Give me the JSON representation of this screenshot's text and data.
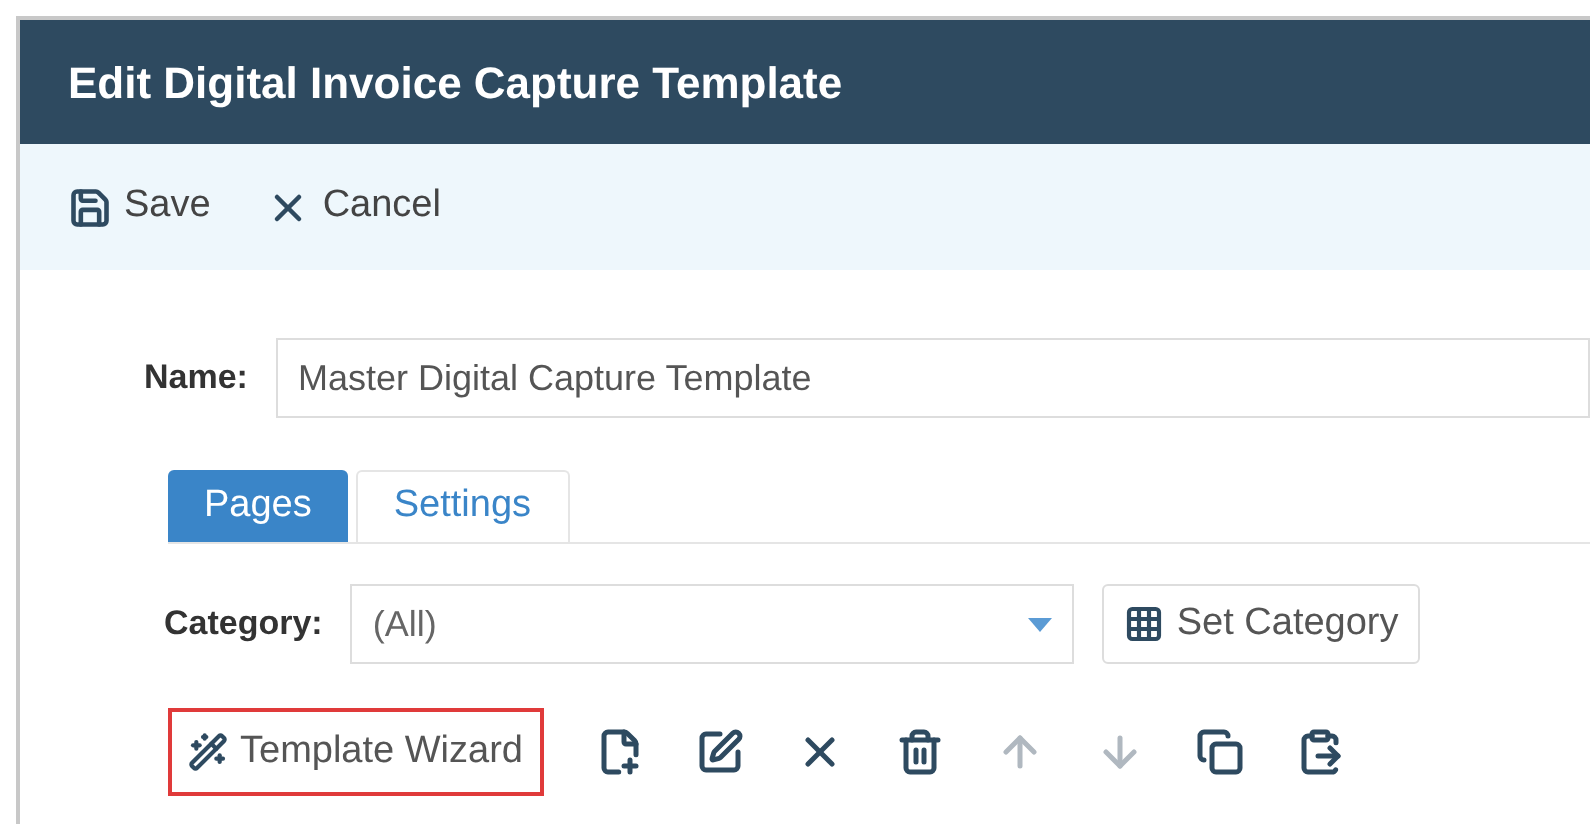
{
  "window": {
    "title": "Edit Digital Invoice Capture Template"
  },
  "toolbar": [
    {
      "kind": "save",
      "label": "Save"
    },
    {
      "kind": "cancel",
      "label": "Cancel"
    }
  ],
  "name_field": {
    "label": "Name:",
    "value": "Master Digital Capture Template"
  },
  "tabs": [
    {
      "label": "Pages",
      "selected": true
    },
    {
      "label": "Settings",
      "selected": false
    }
  ],
  "category": {
    "label": "Category:",
    "value": "(All)",
    "button": "Set Category"
  },
  "page_tools": {
    "wizard": {
      "label": "Template Wizard",
      "highlighted": true
    },
    "icons": [
      {
        "kind": "add-page",
        "disabled": false
      },
      {
        "kind": "edit",
        "disabled": false
      },
      {
        "kind": "remove",
        "disabled": false
      },
      {
        "kind": "delete",
        "disabled": false
      },
      {
        "kind": "up",
        "disabled": true
      },
      {
        "kind": "down",
        "disabled": true
      },
      {
        "kind": "copy",
        "disabled": false
      },
      {
        "kind": "paste",
        "disabled": false
      }
    ]
  }
}
